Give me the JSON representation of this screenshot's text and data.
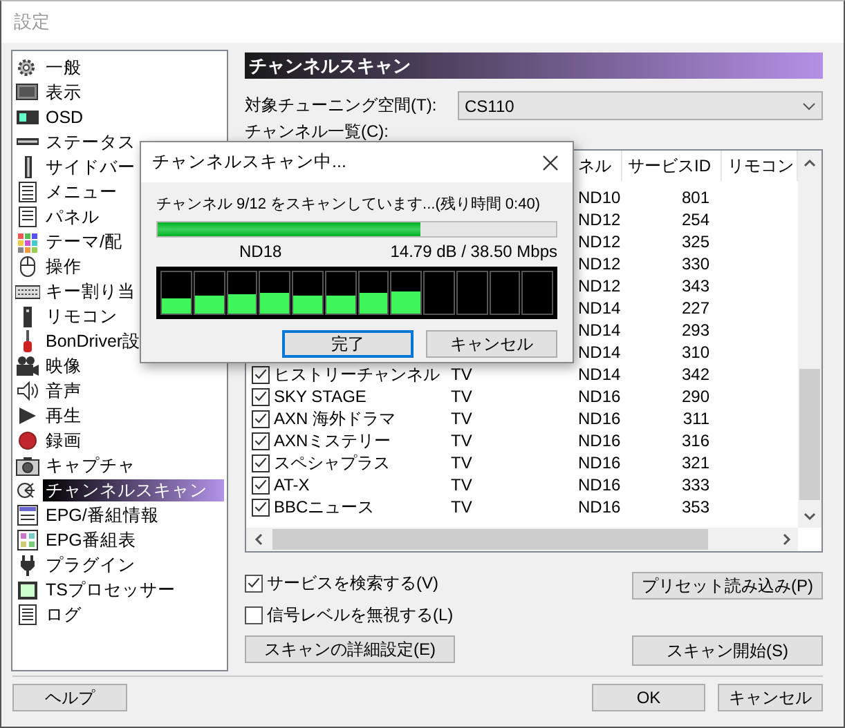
{
  "window": {
    "title": "設定"
  },
  "sidebar": {
    "items": [
      {
        "label": "一般",
        "selected": false
      },
      {
        "label": "表示",
        "selected": false
      },
      {
        "label": "OSD",
        "selected": false
      },
      {
        "label": "ステータス",
        "selected": false
      },
      {
        "label": "サイドバー",
        "selected": false
      },
      {
        "label": "メニュー",
        "selected": false
      },
      {
        "label": "パネル",
        "selected": false
      },
      {
        "label": "テーマ/配",
        "selected": false
      },
      {
        "label": "操作",
        "selected": false
      },
      {
        "label": "キー割り当",
        "selected": false
      },
      {
        "label": "リモコン",
        "selected": false
      },
      {
        "label": "BonDriver設",
        "selected": false
      },
      {
        "label": "映像",
        "selected": false
      },
      {
        "label": "音声",
        "selected": false
      },
      {
        "label": "再生",
        "selected": false
      },
      {
        "label": "録画",
        "selected": false
      },
      {
        "label": "キャプチャ",
        "selected": false
      },
      {
        "label": "チャンネルスキャン",
        "selected": true
      },
      {
        "label": "EPG/番組情報",
        "selected": false
      },
      {
        "label": "EPG番組表",
        "selected": false
      },
      {
        "label": "プラグイン",
        "selected": false
      },
      {
        "label": "TSプロセッサー",
        "selected": false
      },
      {
        "label": "ログ",
        "selected": false
      }
    ]
  },
  "panel": {
    "heading": "チャンネルスキャン",
    "tuning_space": {
      "label": "対象チューニング空間(T):",
      "value": "CS110"
    },
    "list_label": "チャンネル一覧(C):",
    "channel_list": {
      "columns": [
        "ネル",
        "サービスID",
        "リモコン"
      ],
      "rows": [
        {
          "channel": "ND10",
          "service_id": "801"
        },
        {
          "channel": "ND12",
          "service_id": "254"
        },
        {
          "channel": "ND12",
          "service_id": "325"
        },
        {
          "channel": "ND12",
          "service_id": "330"
        },
        {
          "channel": "ND12",
          "service_id": "343"
        },
        {
          "channel": "ND14",
          "service_id": "227"
        },
        {
          "channel": "ND14",
          "service_id": "293"
        },
        {
          "channel": "ND14",
          "service_id": "310"
        },
        {
          "checked": true,
          "name": "ヒストリーチャンネル",
          "type": "TV",
          "channel": "ND14",
          "service_id": "342"
        },
        {
          "checked": true,
          "name": "SKY STAGE",
          "type": "TV",
          "channel": "ND16",
          "service_id": "290"
        },
        {
          "checked": true,
          "name": "AXN 海外ドラマ",
          "type": "TV",
          "channel": "ND16",
          "service_id": "311"
        },
        {
          "checked": true,
          "name": "AXNミステリー",
          "type": "TV",
          "channel": "ND16",
          "service_id": "316"
        },
        {
          "checked": true,
          "name": "スペシャプラス",
          "type": "TV",
          "channel": "ND16",
          "service_id": "321"
        },
        {
          "checked": true,
          "name": "AT-X",
          "type": "TV",
          "channel": "ND16",
          "service_id": "333"
        },
        {
          "checked": true,
          "name": "BBCニュース",
          "type": "TV",
          "channel": "ND16",
          "service_id": "353"
        }
      ]
    },
    "options": [
      {
        "label": "サービスを検索する(V)",
        "checked": true
      },
      {
        "label": "信号レベルを無視する(L)",
        "checked": false
      }
    ],
    "buttons": {
      "details": "スキャンの詳細設定(E)",
      "preset": "プリセット読み込み(P)",
      "start": "スキャン開始(S)"
    }
  },
  "footer": {
    "help": "ヘルプ",
    "ok": "OK",
    "cancel": "キャンセル"
  },
  "dialog": {
    "title": "チャンネルスキャン中...",
    "message": "チャンネル 9/12 をスキャンしています...(残り時間 0:40)",
    "progress": {
      "level": 0.66
    },
    "channel": "ND18",
    "signal": "14.79 dB / 38.50 Mbps",
    "meter": [
      {
        "level": 0.38
      },
      {
        "level": 0.43
      },
      {
        "level": 0.47
      },
      {
        "level": 0.51
      },
      {
        "level": 0.43
      },
      {
        "level": 0.43
      },
      {
        "level": 0.51
      },
      {
        "level": 0.55
      },
      {
        "level": 0
      },
      {
        "level": 0
      },
      {
        "level": 0
      },
      {
        "level": 0
      }
    ],
    "buttons": [
      {
        "label": "完了",
        "default": true
      },
      {
        "label": "キャンセル",
        "default": false
      }
    ]
  }
}
